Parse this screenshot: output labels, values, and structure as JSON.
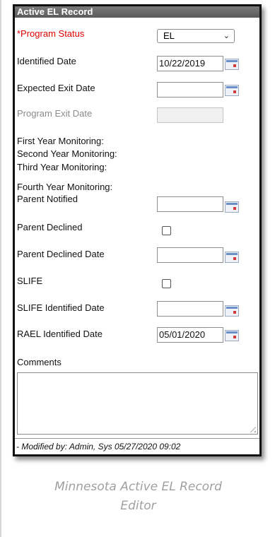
{
  "panel": {
    "title": "Active EL Record",
    "program_status": {
      "label": "*Program Status",
      "value": "EL"
    },
    "identified_date": {
      "label": "Identified Date",
      "value": "10/22/2019"
    },
    "expected_exit_date": {
      "label": "Expected Exit Date",
      "value": ""
    },
    "program_exit_date": {
      "label": "Program Exit Date",
      "value": ""
    },
    "monitoring": [
      "First Year Monitoring:",
      "Second Year Monitoring:",
      "Third Year Monitoring:",
      "Fourth Year Monitoring:"
    ],
    "parent_notified": {
      "label": "Parent Notified",
      "value": ""
    },
    "parent_declined": {
      "label": "Parent Declined"
    },
    "parent_declined_date": {
      "label": "Parent Declined Date",
      "value": ""
    },
    "slife": {
      "label": "SLIFE"
    },
    "slife_identified_date": {
      "label": "SLIFE Identified Date",
      "value": ""
    },
    "rael_identified_date": {
      "label": "RAEL Identified Date",
      "value": "05/01/2020"
    },
    "comments": {
      "label": "Comments",
      "value": ""
    },
    "footer": "- Modified by: Admin, Sys 05/27/2020 09:02"
  },
  "caption": [
    "Minnesota Active EL Record",
    "Editor"
  ],
  "colors": {
    "required": "#e00000",
    "header": "#6a6a6a",
    "disabled_text": "#8a8a8a",
    "caption": "#a0a0a0"
  }
}
